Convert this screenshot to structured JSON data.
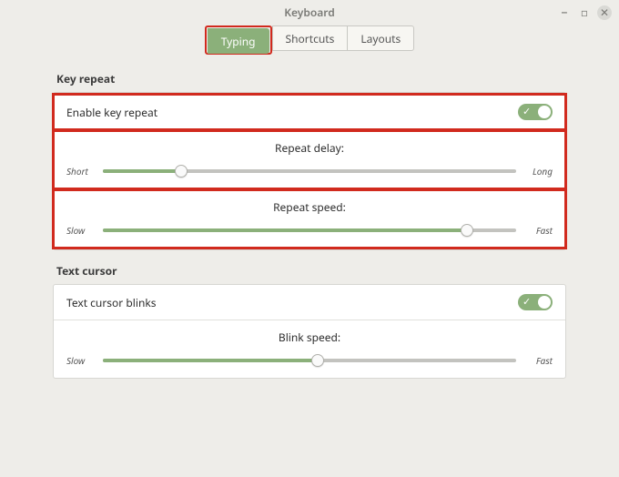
{
  "window": {
    "title": "Keyboard"
  },
  "tabs": {
    "typing": "Typing",
    "shortcuts": "Shortcuts",
    "layouts": "Layouts",
    "active_index": 0
  },
  "sections": {
    "key_repeat": {
      "heading": "Key repeat",
      "enable_label": "Enable key repeat",
      "enable_value": true,
      "delay": {
        "title": "Repeat delay:",
        "min_label": "Short",
        "max_label": "Long",
        "value_pct": 19
      },
      "speed": {
        "title": "Repeat speed:",
        "min_label": "Slow",
        "max_label": "Fast",
        "value_pct": 88
      }
    },
    "text_cursor": {
      "heading": "Text cursor",
      "blink_label": "Text cursor blinks",
      "blink_value": true,
      "speed": {
        "title": "Blink speed:",
        "min_label": "Slow",
        "max_label": "Fast",
        "value_pct": 52
      }
    }
  }
}
